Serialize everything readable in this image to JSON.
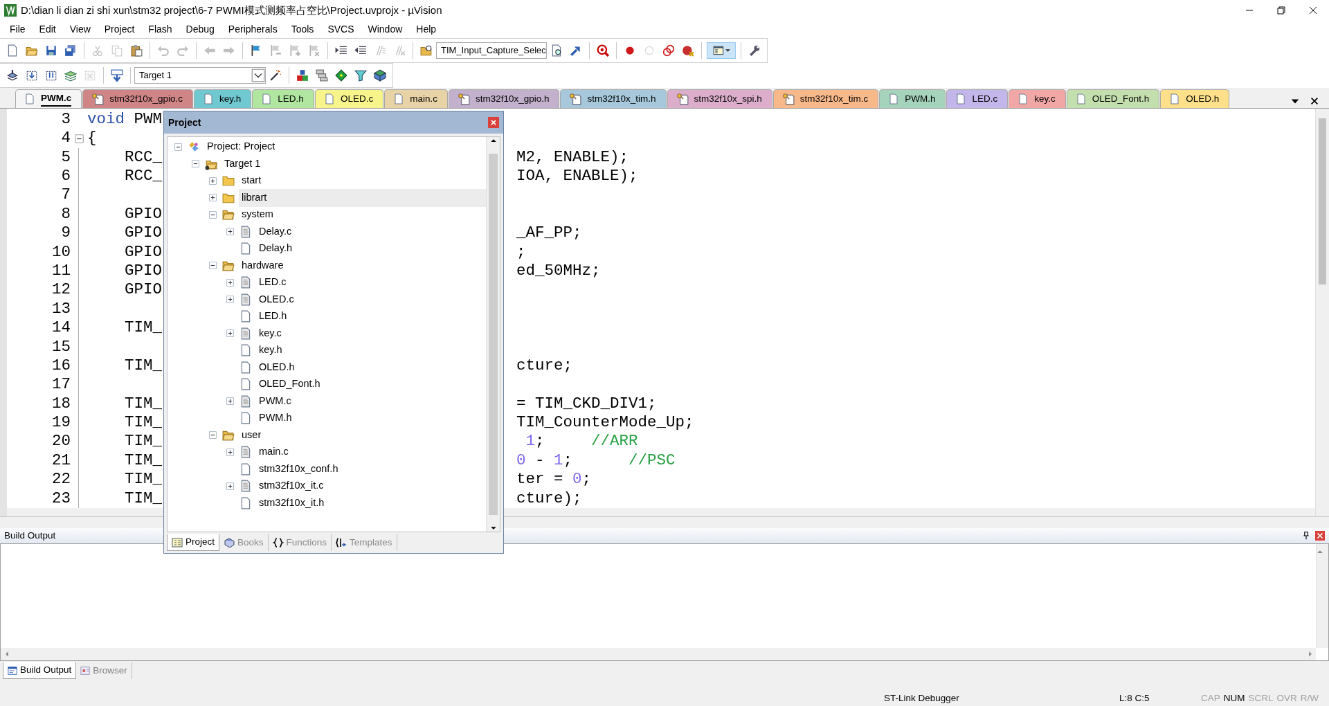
{
  "window": {
    "title": "D:\\dian li dian zi shi xun\\stm32 project\\6-7 PWMI模式测频率占空比\\Project.uvprojx - µVision"
  },
  "menu": [
    "File",
    "Edit",
    "View",
    "Project",
    "Flash",
    "Debug",
    "Peripherals",
    "Tools",
    "SVCS",
    "Window",
    "Help"
  ],
  "toolbar_1": [
    [
      {
        "kind": "new",
        "disabled": false
      },
      {
        "kind": "open",
        "disabled": false
      },
      {
        "kind": "save",
        "disabled": false
      },
      {
        "kind": "save_all",
        "disabled": false
      }
    ],
    [
      {
        "kind": "cut",
        "disabled": true
      },
      {
        "kind": "copy",
        "disabled": true
      },
      {
        "kind": "paste",
        "disabled": false
      }
    ],
    [
      {
        "kind": "undo",
        "disabled": true
      },
      {
        "kind": "redo",
        "disabled": true
      }
    ],
    [
      {
        "kind": "back",
        "disabled": true
      },
      {
        "kind": "forward",
        "disabled": true
      }
    ],
    [
      {
        "kind": "bookmark",
        "disabled": false
      },
      {
        "kind": "bookmark_prev",
        "disabled": true
      },
      {
        "kind": "bookmark_next",
        "disabled": true
      },
      {
        "kind": "bookmark_clear",
        "disabled": true
      }
    ],
    [
      {
        "kind": "indent",
        "disabled": false
      },
      {
        "kind": "outdent",
        "disabled": false
      },
      {
        "kind": "comment",
        "disabled": true
      },
      {
        "kind": "uncomment",
        "disabled": true
      }
    ],
    [
      {
        "kind": "find_folder",
        "disabled": false
      },
      {
        "kind": "combo",
        "disabled": false,
        "value": "TIM_Input_Capture_Selec"
      },
      {
        "kind": "find",
        "disabled": false
      },
      {
        "kind": "incremental",
        "disabled": false
      }
    ],
    [
      {
        "kind": "debug",
        "disabled": false
      }
    ],
    [
      {
        "kind": "breakpoint",
        "disabled": false
      },
      {
        "kind": "bp_disable",
        "disabled": true
      },
      {
        "kind": "bp_disable_all",
        "disabled": false
      },
      {
        "kind": "bp_kill",
        "disabled": false
      }
    ],
    [
      {
        "kind": "windows",
        "disabled": false,
        "selected": true
      }
    ],
    [
      {
        "kind": "config",
        "disabled": false
      }
    ]
  ],
  "toolbar_2": [
    [
      {
        "kind": "translate",
        "disabled": false
      },
      {
        "kind": "build",
        "disabled": false
      },
      {
        "kind": "rebuild",
        "disabled": false
      },
      {
        "kind": "batch",
        "disabled": false
      },
      {
        "kind": "stop",
        "disabled": true
      }
    ],
    [
      {
        "kind": "load",
        "disabled": false
      }
    ],
    [
      {
        "kind": "combo",
        "disabled": false,
        "value": "Target 1"
      },
      {
        "kind": "options",
        "disabled": false
      }
    ],
    [
      {
        "kind": "rte",
        "disabled": false
      },
      {
        "kind": "extensions",
        "disabled": false
      },
      {
        "kind": "diamond",
        "disabled": false
      },
      {
        "kind": "funnel",
        "disabled": false
      },
      {
        "kind": "packs",
        "disabled": false
      }
    ]
  ],
  "tabs": [
    {
      "label": "PWM.c",
      "kind": "file",
      "selected": true,
      "color": "#f3f3f3"
    },
    {
      "label": "stm32f10x_gpio.c",
      "kind": "locked",
      "selected": false,
      "color": "#cf8585"
    },
    {
      "label": "key.h",
      "kind": "file",
      "selected": false,
      "color": "#70c8d0"
    },
    {
      "label": "LED.h",
      "kind": "file",
      "selected": false,
      "color": "#b0e6a0"
    },
    {
      "label": "OLED.c",
      "kind": "file",
      "selected": false,
      "color": "#f6f48a"
    },
    {
      "label": "main.c",
      "kind": "file",
      "selected": false,
      "color": "#e8d3a6"
    },
    {
      "label": "stm32f10x_gpio.h",
      "kind": "locked",
      "selected": false,
      "color": "#c2b0cc"
    },
    {
      "label": "stm32f10x_tim.h",
      "kind": "locked",
      "selected": false,
      "color": "#a6c8da"
    },
    {
      "label": "stm32f10x_spi.h",
      "kind": "locked",
      "selected": false,
      "color": "#dcaecb"
    },
    {
      "label": "stm32f10x_tim.c",
      "kind": "locked",
      "selected": false,
      "color": "#f7b88a"
    },
    {
      "label": "PWM.h",
      "kind": "file",
      "selected": false,
      "color": "#a5d3bb"
    },
    {
      "label": "LED.c",
      "kind": "file",
      "selected": false,
      "color": "#c3b6ea"
    },
    {
      "label": "key.c",
      "kind": "file",
      "selected": false,
      "color": "#f2a7a7"
    },
    {
      "label": "OLED_Font.h",
      "kind": "file",
      "selected": false,
      "color": "#c4dfae"
    },
    {
      "label": "OLED.h",
      "kind": "file",
      "selected": false,
      "color": "#ffe08a"
    }
  ],
  "editor": {
    "lines": [
      {
        "number": "3",
        "fold": false,
        "left": [
          {
            "text": "void",
            "kind": "keyword"
          },
          {
            "text": " PWM",
            "kind": "code"
          }
        ]
      },
      {
        "number": "4",
        "fold": true,
        "left": [
          {
            "text": "{",
            "kind": "code"
          }
        ]
      },
      {
        "number": "5",
        "fold": false,
        "left": [
          {
            "text": "    RCC_",
            "kind": "code"
          }
        ],
        "right": [
          {
            "text": "M2, ENABLE);",
            "kind": "code"
          }
        ]
      },
      {
        "number": "6",
        "fold": false,
        "left": [
          {
            "text": "    RCC_",
            "kind": "code"
          }
        ],
        "right": [
          {
            "text": "IOA, ENABLE);",
            "kind": "code"
          }
        ]
      },
      {
        "number": "7",
        "fold": false
      },
      {
        "number": "8",
        "fold": false,
        "left": [
          {
            "text": "    GPIO",
            "kind": "code"
          }
        ]
      },
      {
        "number": "9",
        "fold": false,
        "left": [
          {
            "text": "    GPIO",
            "kind": "code"
          }
        ],
        "right": [
          {
            "text": "_AF_PP;",
            "kind": "code"
          }
        ]
      },
      {
        "number": "10",
        "fold": false,
        "left": [
          {
            "text": "    GPIO",
            "kind": "code"
          }
        ],
        "right": [
          {
            "text": ";",
            "kind": "code"
          }
        ]
      },
      {
        "number": "11",
        "fold": false,
        "left": [
          {
            "text": "    GPIO",
            "kind": "code"
          }
        ],
        "right": [
          {
            "text": "ed_50MHz;",
            "kind": "code"
          }
        ]
      },
      {
        "number": "12",
        "fold": false,
        "left": [
          {
            "text": "    GPIO",
            "kind": "code"
          }
        ]
      },
      {
        "number": "13",
        "fold": false
      },
      {
        "number": "14",
        "fold": false,
        "left": [
          {
            "text": "    TIM_",
            "kind": "code"
          }
        ]
      },
      {
        "number": "15",
        "fold": false
      },
      {
        "number": "16",
        "fold": false,
        "left": [
          {
            "text": "    TIM_",
            "kind": "code"
          }
        ],
        "right": [
          {
            "text": "cture;",
            "kind": "code"
          }
        ]
      },
      {
        "number": "17",
        "fold": false
      },
      {
        "number": "18",
        "fold": false,
        "left": [
          {
            "text": "    TIM_",
            "kind": "code"
          }
        ],
        "right": [
          {
            "text": "= TIM_CKD_DIV1;",
            "kind": "code"
          }
        ]
      },
      {
        "number": "19",
        "fold": false,
        "left": [
          {
            "text": "    TIM_",
            "kind": "code"
          }
        ],
        "right": [
          {
            "text": "TIM_CounterMode_Up;",
            "kind": "code"
          }
        ]
      },
      {
        "number": "20",
        "fold": false,
        "left": [
          {
            "text": "    TIM_",
            "kind": "code"
          }
        ],
        "right": [
          {
            "text": " 1",
            "kind": "number"
          },
          {
            "text": ";     ",
            "kind": "code"
          },
          {
            "text": "//ARR",
            "kind": "comment"
          }
        ]
      },
      {
        "number": "21",
        "fold": false,
        "left": [
          {
            "text": "    TIM_",
            "kind": "code"
          }
        ],
        "right": [
          {
            "text": "0",
            "kind": "number"
          },
          {
            "text": " - ",
            "kind": "code"
          },
          {
            "text": "1",
            "kind": "number"
          },
          {
            "text": ";      ",
            "kind": "code"
          },
          {
            "text": "//PSC",
            "kind": "comment"
          }
        ]
      },
      {
        "number": "22",
        "fold": false,
        "left": [
          {
            "text": "    TIM_",
            "kind": "code"
          }
        ],
        "right": [
          {
            "text": "ter = ",
            "kind": "code"
          },
          {
            "text": "0",
            "kind": "number"
          },
          {
            "text": ";",
            "kind": "code"
          }
        ]
      },
      {
        "number": "23",
        "fold": false,
        "left": [
          {
            "text": "    TIM_",
            "kind": "code"
          }
        ],
        "right": [
          {
            "text": "cture);",
            "kind": "code"
          }
        ]
      }
    ]
  },
  "project_panel": {
    "title": "Project",
    "tree": [
      {
        "label": "Project: Project",
        "kind": "project",
        "expanded": true,
        "selected": false,
        "children": [
          {
            "label": "Target 1",
            "kind": "target",
            "expanded": true,
            "selected": false,
            "children": [
              {
                "label": "start",
                "kind": "folder",
                "expanded": false,
                "selected": false
              },
              {
                "label": "librart",
                "kind": "folder",
                "expanded": false,
                "selected": true
              },
              {
                "label": "system",
                "kind": "folder",
                "expanded": true,
                "selected": false,
                "children": [
                  {
                    "label": "Delay.c",
                    "kind": "source",
                    "expanded": false,
                    "selected": false
                  },
                  {
                    "label": "Delay.h",
                    "kind": "header",
                    "selected": false
                  }
                ]
              },
              {
                "label": "hardware",
                "kind": "folder",
                "expanded": true,
                "selected": false,
                "children": [
                  {
                    "label": "LED.c",
                    "kind": "source",
                    "expanded": false,
                    "selected": false
                  },
                  {
                    "label": "OLED.c",
                    "kind": "source",
                    "expanded": false,
                    "selected": false
                  },
                  {
                    "label": "LED.h",
                    "kind": "header",
                    "selected": false
                  },
                  {
                    "label": "key.c",
                    "kind": "source",
                    "expanded": false,
                    "selected": false
                  },
                  {
                    "label": "key.h",
                    "kind": "header",
                    "selected": false
                  },
                  {
                    "label": "OLED.h",
                    "kind": "header",
                    "selected": false
                  },
                  {
                    "label": "OLED_Font.h",
                    "kind": "header",
                    "selected": false
                  },
                  {
                    "label": "PWM.c",
                    "kind": "source",
                    "expanded": false,
                    "selected": false
                  },
                  {
                    "label": "PWM.h",
                    "kind": "header",
                    "selected": false
                  }
                ]
              },
              {
                "label": "user",
                "kind": "folder",
                "expanded": true,
                "selected": false,
                "children": [
                  {
                    "label": "main.c",
                    "kind": "source",
                    "expanded": false,
                    "selected": false
                  },
                  {
                    "label": "stm32f10x_conf.h",
                    "kind": "header",
                    "selected": false
                  },
                  {
                    "label": "stm32f10x_it.c",
                    "kind": "source",
                    "expanded": false,
                    "selected": false
                  },
                  {
                    "label": "stm32f10x_it.h",
                    "kind": "header",
                    "selected": false
                  }
                ]
              }
            ]
          }
        ]
      }
    ],
    "tabs": [
      {
        "label": "Project",
        "kind": "project",
        "selected": true
      },
      {
        "label": "Books",
        "kind": "books",
        "selected": false
      },
      {
        "label": "Functions",
        "kind": "functions",
        "selected": false
      },
      {
        "label": "Templates",
        "kind": "templates",
        "selected": false
      }
    ]
  },
  "build_output": {
    "title": "Build Output",
    "tabs": [
      {
        "label": "Build Output",
        "kind": "output",
        "selected": true
      },
      {
        "label": "Browser",
        "kind": "browser",
        "selected": false
      }
    ]
  },
  "status_bar": {
    "debugger": "ST-Link Debugger",
    "position": "L:8 C:5",
    "indicators": [
      {
        "label": "CAP",
        "on": false
      },
      {
        "label": "NUM",
        "on": true
      },
      {
        "label": "SCRL",
        "on": false
      },
      {
        "label": "OVR",
        "on": false
      },
      {
        "label": "R/W",
        "on": false
      }
    ]
  }
}
